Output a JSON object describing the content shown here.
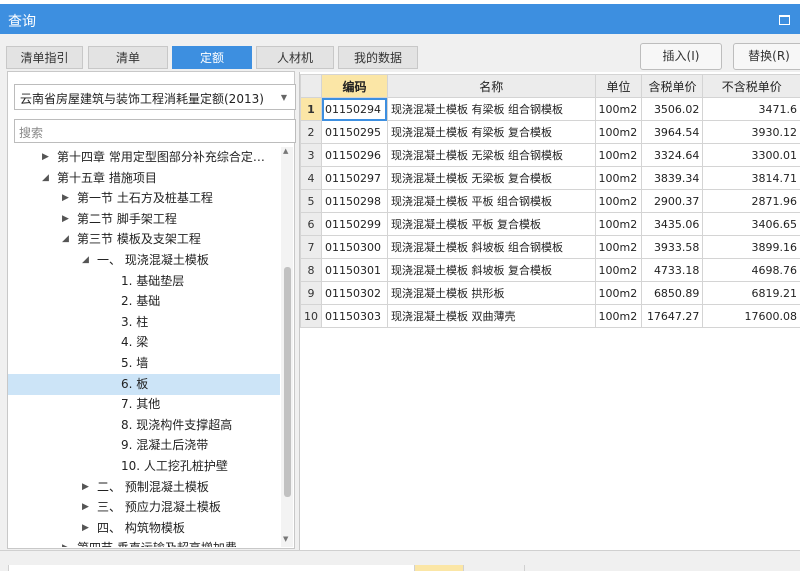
{
  "window": {
    "title": "查询"
  },
  "tabs": [
    {
      "label": "清单指引",
      "active": false
    },
    {
      "label": "清单",
      "active": false
    },
    {
      "label": "定额",
      "active": true
    },
    {
      "label": "人材机",
      "active": false
    },
    {
      "label": "我的数据",
      "active": false
    }
  ],
  "toolbar": {
    "insert_label": "插入(I)",
    "replace_label": "替换(R)"
  },
  "library_select": {
    "value": "云南省房屋建筑与装饰工程消耗量定额(2013)"
  },
  "search": {
    "placeholder": "搜索"
  },
  "tree": [
    {
      "label": "第十四章 常用定型图部分补充综合定…",
      "level": 0,
      "toggle": "collapsed"
    },
    {
      "label": "第十五章 措施项目",
      "level": 0,
      "toggle": "expanded"
    },
    {
      "label": "第一节 土石方及桩基工程",
      "level": 1,
      "toggle": "collapsed"
    },
    {
      "label": "第二节 脚手架工程",
      "level": 1,
      "toggle": "collapsed"
    },
    {
      "label": "第三节 模板及支架工程",
      "level": 1,
      "toggle": "expanded"
    },
    {
      "label": "一、 现浇混凝土模板",
      "level": 2,
      "toggle": "expanded"
    },
    {
      "label": "1. 基础垫层",
      "level": 3,
      "toggle": "none"
    },
    {
      "label": "2. 基础",
      "level": 3,
      "toggle": "none"
    },
    {
      "label": "3. 柱",
      "level": 3,
      "toggle": "none"
    },
    {
      "label": "4. 梁",
      "level": 3,
      "toggle": "none"
    },
    {
      "label": "5. 墙",
      "level": 3,
      "toggle": "none"
    },
    {
      "label": "6. 板",
      "level": 3,
      "toggle": "none",
      "selected": true
    },
    {
      "label": "7. 其他",
      "level": 3,
      "toggle": "none"
    },
    {
      "label": "8. 现浇构件支撑超高",
      "level": 3,
      "toggle": "none"
    },
    {
      "label": "9. 混凝土后浇带",
      "level": 3,
      "toggle": "none"
    },
    {
      "label": "10. 人工挖孔桩护壁",
      "level": 3,
      "toggle": "none"
    },
    {
      "label": "二、 预制混凝土模板",
      "level": 2,
      "toggle": "collapsed"
    },
    {
      "label": "三、 预应力混凝土模板",
      "level": 2,
      "toggle": "collapsed"
    },
    {
      "label": "四、 构筑物模板",
      "level": 2,
      "toggle": "collapsed"
    },
    {
      "label": "第四节 垂直运输及超高增加费",
      "level": 1,
      "toggle": "collapsed"
    }
  ],
  "table": {
    "headers": [
      "编码",
      "名称",
      "单位",
      "含税单价",
      "不含税单价"
    ],
    "rows": [
      {
        "idx": "1",
        "code": "01150294",
        "name": "现浇混凝土模板 有梁板 组合钢模板",
        "unit": "100m2",
        "price_tax": "3506.02",
        "price_notax": "3471.6"
      },
      {
        "idx": "2",
        "code": "01150295",
        "name": "现浇混凝土模板 有梁板 复合模板",
        "unit": "100m2",
        "price_tax": "3964.54",
        "price_notax": "3930.12"
      },
      {
        "idx": "3",
        "code": "01150296",
        "name": "现浇混凝土模板 无梁板 组合钢模板",
        "unit": "100m2",
        "price_tax": "3324.64",
        "price_notax": "3300.01"
      },
      {
        "idx": "4",
        "code": "01150297",
        "name": "现浇混凝土模板 无梁板 复合模板",
        "unit": "100m2",
        "price_tax": "3839.34",
        "price_notax": "3814.71"
      },
      {
        "idx": "5",
        "code": "01150298",
        "name": "现浇混凝土模板 平板 组合钢模板",
        "unit": "100m2",
        "price_tax": "2900.37",
        "price_notax": "2871.96"
      },
      {
        "idx": "6",
        "code": "01150299",
        "name": "现浇混凝土模板 平板 复合模板",
        "unit": "100m2",
        "price_tax": "3435.06",
        "price_notax": "3406.65"
      },
      {
        "idx": "7",
        "code": "01150300",
        "name": "现浇混凝土模板 斜坡板 组合钢模板",
        "unit": "100m2",
        "price_tax": "3933.58",
        "price_notax": "3899.16"
      },
      {
        "idx": "8",
        "code": "01150301",
        "name": "现浇混凝土模板 斜坡板 复合模板",
        "unit": "100m2",
        "price_tax": "4733.18",
        "price_notax": "4698.76"
      },
      {
        "idx": "9",
        "code": "01150302",
        "name": "现浇混凝土模板 拱形板",
        "unit": "100m2",
        "price_tax": "6850.89",
        "price_notax": "6819.21"
      },
      {
        "idx": "10",
        "code": "01150303",
        "name": "现浇混凝土模板 双曲薄壳",
        "unit": "100m2",
        "price_tax": "17647.27",
        "price_notax": "17600.08"
      }
    ]
  },
  "colors": {
    "accent": "#3d8fe0",
    "header_highlight": "#fbe6a6",
    "selection": "#cce4f7"
  }
}
